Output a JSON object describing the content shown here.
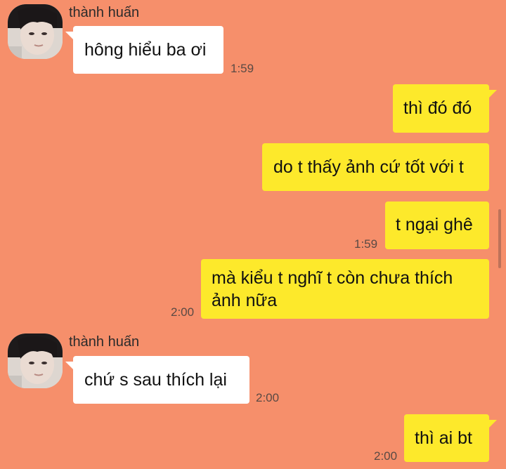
{
  "chat": {
    "contact_name": "thành huấn",
    "messages": [
      {
        "from": "contact",
        "text": "hông hiểu ba ơi",
        "time": "1:59"
      },
      {
        "from": "me",
        "text": "thì đó đó"
      },
      {
        "from": "me",
        "text": "do t thấy ảnh cứ tốt với t"
      },
      {
        "from": "me",
        "text": "t ngại ghê",
        "time": "1:59"
      },
      {
        "from": "me",
        "text_line1": "mà kiểu t nghĩ t còn chưa thích",
        "text_line2": "ảnh nữa",
        "time": "2:00"
      },
      {
        "from": "contact",
        "text": "chứ s sau thích lại",
        "time": "2:00"
      },
      {
        "from": "me",
        "text": "thì ai bt",
        "time": "2:00"
      }
    ]
  },
  "colors": {
    "background": "#f68f6b",
    "incoming_bubble": "#ffffff",
    "outgoing_bubble": "#fde92b"
  }
}
